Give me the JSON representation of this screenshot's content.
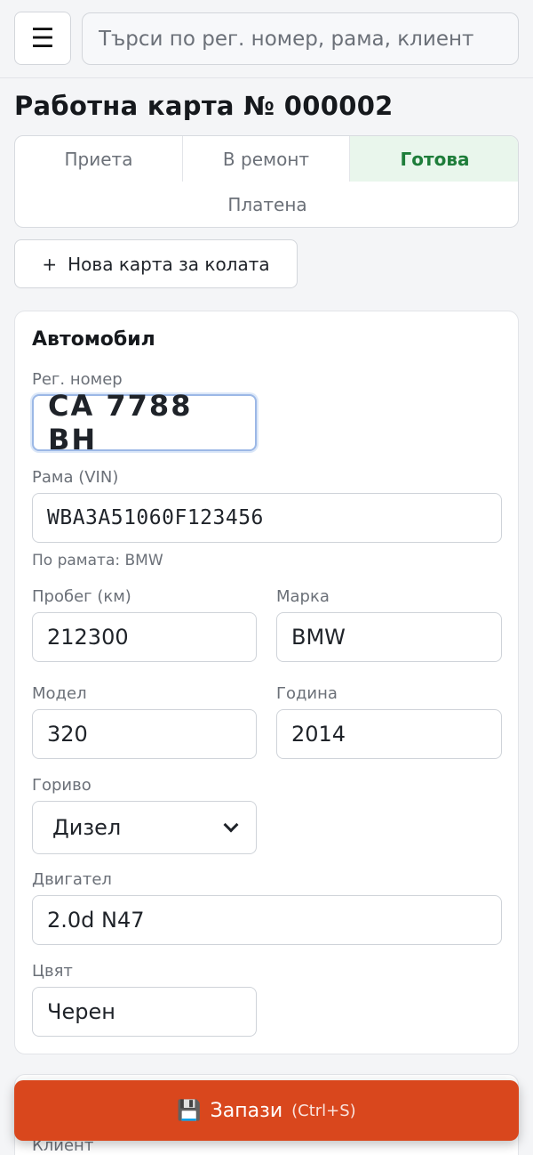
{
  "topbar": {
    "menu_icon": "☰",
    "search_placeholder": "Търси по рег. номер, рама, клиент"
  },
  "page_title": "Работна карта № 000002",
  "status_tabs": [
    {
      "label": "Приета",
      "active": false
    },
    {
      "label": "В ремонт",
      "active": false
    },
    {
      "label": "Готова",
      "active": true
    },
    {
      "label": "Платена",
      "active": false
    }
  ],
  "new_card": {
    "plus": "+",
    "label": "Нова карта за колата"
  },
  "vehicle": {
    "section_title": "Автомобил",
    "reg_label": "Рег. номер",
    "reg_value": "СА 7788 ВН",
    "vin_label": "Рама (VIN)",
    "vin_value": "WBA3A51060F123456",
    "vin_hint": "По рамата: BMW",
    "mileage_label": "Пробег (км)",
    "mileage_value": "212300",
    "make_label": "Марка",
    "make_value": "BMW",
    "model_label": "Модел",
    "model_value": "320",
    "year_label": "Година",
    "year_value": "2014",
    "fuel_label": "Гориво",
    "fuel_value": "Дизел",
    "engine_label": "Двигател",
    "engine_value": "2.0d N47",
    "color_label": "Цвят",
    "color_value": "Черен"
  },
  "client": {
    "label": "Клиент"
  },
  "save": {
    "icon": "💾",
    "label": "Запази",
    "shortcut": "(Ctrl+S)"
  },
  "colors": {
    "accent": "#d9471d",
    "active_tab_bg": "#e9f6ec",
    "active_tab_text": "#1e7d3a"
  }
}
